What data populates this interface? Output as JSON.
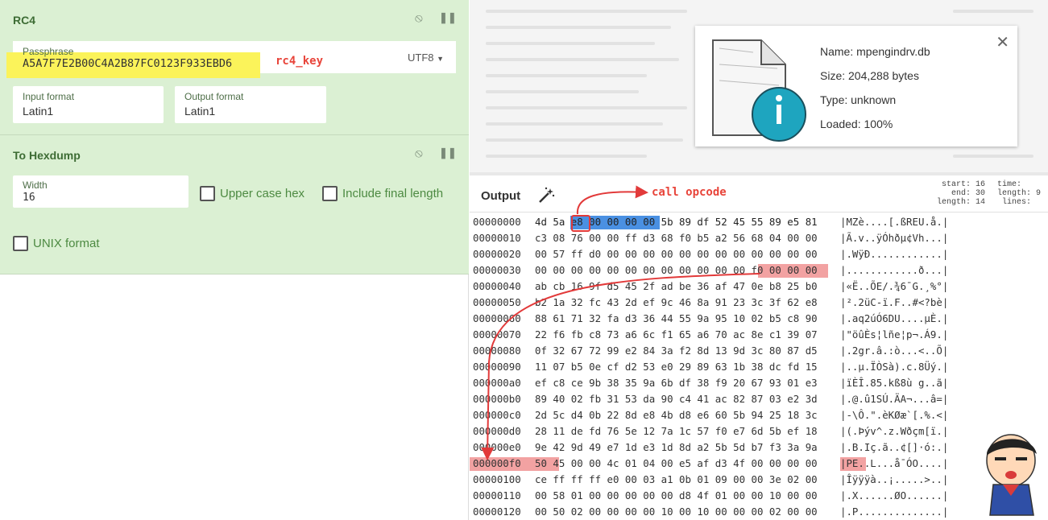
{
  "recipe": {
    "rc4": {
      "title": "RC4",
      "passphrase_label": "Passphrase",
      "passphrase_value": "A5A7F7E2B00C4A2B87FC0123F933EBD6",
      "encoding": "UTF8",
      "input_format_label": "Input format",
      "input_format_value": "Latin1",
      "output_format_label": "Output format",
      "output_format_value": "Latin1"
    },
    "hexdump": {
      "title": "To Hexdump",
      "width_label": "Width",
      "width_value": "16",
      "upper_case_label": "Upper case hex",
      "include_final_label": "Include final length",
      "unix_label": "UNIX format"
    }
  },
  "annotations": {
    "rc4_key": "rc4_key",
    "call_opcode": "call opcode"
  },
  "file_info": {
    "name": "Name: mpengindrv.db",
    "size": "Size: 204,288 bytes",
    "type": "Type: unknown",
    "loaded": "Loaded: 100%"
  },
  "output": {
    "title": "Output",
    "stats_left": "start: 16\n  end: 30\nlength: 14",
    "stats_right": "time:\nlength: 9\n lines:"
  },
  "hexdump_rows": [
    {
      "offset": "00000000",
      "hex": "4d 5a e8 00 00 00 00 5b 89 df 52 45 55 89 e5 81",
      "ascii": "|MZè....[.ßREU.å.|"
    },
    {
      "offset": "00000010",
      "hex": "c3 08 76 00 00 ff d3 68 f0 b5 a2 56 68 04 00 00",
      "ascii": "|Ã.v..ÿÓhðµ¢Vh...|"
    },
    {
      "offset": "00000020",
      "hex": "00 57 ff d0 00 00 00 00 00 00 00 00 00 00 00 00",
      "ascii": "|.WÿÐ............|"
    },
    {
      "offset": "00000030",
      "hex": "00 00 00 00 00 00 00 00 00 00 00 00 f0 00 00 00",
      "ascii": "|............ð...|"
    },
    {
      "offset": "00000040",
      "hex": "ab cb 16 9f d5 45 2f ad be 36 af 47 0e b8 25 b0",
      "ascii": "|«Ë..ÕE/.¾6¯G.¸%°|"
    },
    {
      "offset": "00000050",
      "hex": "b2 1a 32 fc 43 2d ef 9c 46 8a 91 23 3c 3f 62 e8",
      "ascii": "|².2üC-ï.F..#<?bè|"
    },
    {
      "offset": "00000060",
      "hex": "88 61 71 32 fa d3 36 44 55 9a 95 10 02 b5 c8 90",
      "ascii": "|.aq2úÓ6DU....µÈ.|"
    },
    {
      "offset": "00000070",
      "hex": "22 f6 fb c8 73 a6 6c f1 65 a6 70 ac 8e c1 39 07",
      "ascii": "|\"öûÈs¦lñe¦p¬.Á9.|"
    },
    {
      "offset": "00000080",
      "hex": "0f 32 67 72 99 e2 84 3a f2 8d 13 9d 3c 80 87 d5",
      "ascii": "|.2gr.â.:ò...<..Õ|"
    },
    {
      "offset": "00000090",
      "hex": "11 07 b5 0e cf d2 53 e0 29 89 63 1b 38 dc fd 15",
      "ascii": "|..µ.ÏÒSà).c.8Üý.|"
    },
    {
      "offset": "000000a0",
      "hex": "ef c8 ce 9b 38 35 9a 6b df 38 f9 20 67 93 01 e3",
      "ascii": "|ïÈÎ.85.kß8ù g..ã|"
    },
    {
      "offset": "000000b0",
      "hex": "89 40 02 fb 31 53 da 90 c4 41 ac 82 87 03 e2 3d",
      "ascii": "|.@.û1SÚ.ÄA¬...â=|"
    },
    {
      "offset": "000000c0",
      "hex": "2d 5c d4 0b 22 8d e8 4b d8 e6 60 5b 94 25 18 3c",
      "ascii": "|-\\Ô.\".èKØæ`[.%.<|"
    },
    {
      "offset": "000000d0",
      "hex": "28 11 de fd 76 5e 12 7a 1c 57 f0 e7 6d 5b ef 18",
      "ascii": "|(.Þýv^.z.Wðçm[ï.|"
    },
    {
      "offset": "000000e0",
      "hex": "9e 42 9d 49 e7 1d e3 1d 8d a2 5b 5d b7 f3 3a 9a",
      "ascii": "|.B.Iç.ã..¢[]·ó:.|"
    },
    {
      "offset": "000000f0",
      "hex": "50 45 00 00 4c 01 04 00 e5 af d3 4f 00 00 00 00",
      "ascii": "|PE..L...å¯ÓO....|"
    },
    {
      "offset": "00000100",
      "hex": "ce ff ff ff e0 00 03 a1 0b 01 09 00 00 3e 02 00",
      "ascii": "|Îÿÿÿà..¡.....>..|"
    },
    {
      "offset": "00000110",
      "hex": "00 58 01 00 00 00 00 00 d8 4f 01 00 00 10 00 00",
      "ascii": "|.X......ØO......|"
    },
    {
      "offset": "00000120",
      "hex": "00 50 02 00 00 00 00 10 00 10 00 00 00 02 00 00",
      "ascii": "|.P..............|"
    }
  ]
}
